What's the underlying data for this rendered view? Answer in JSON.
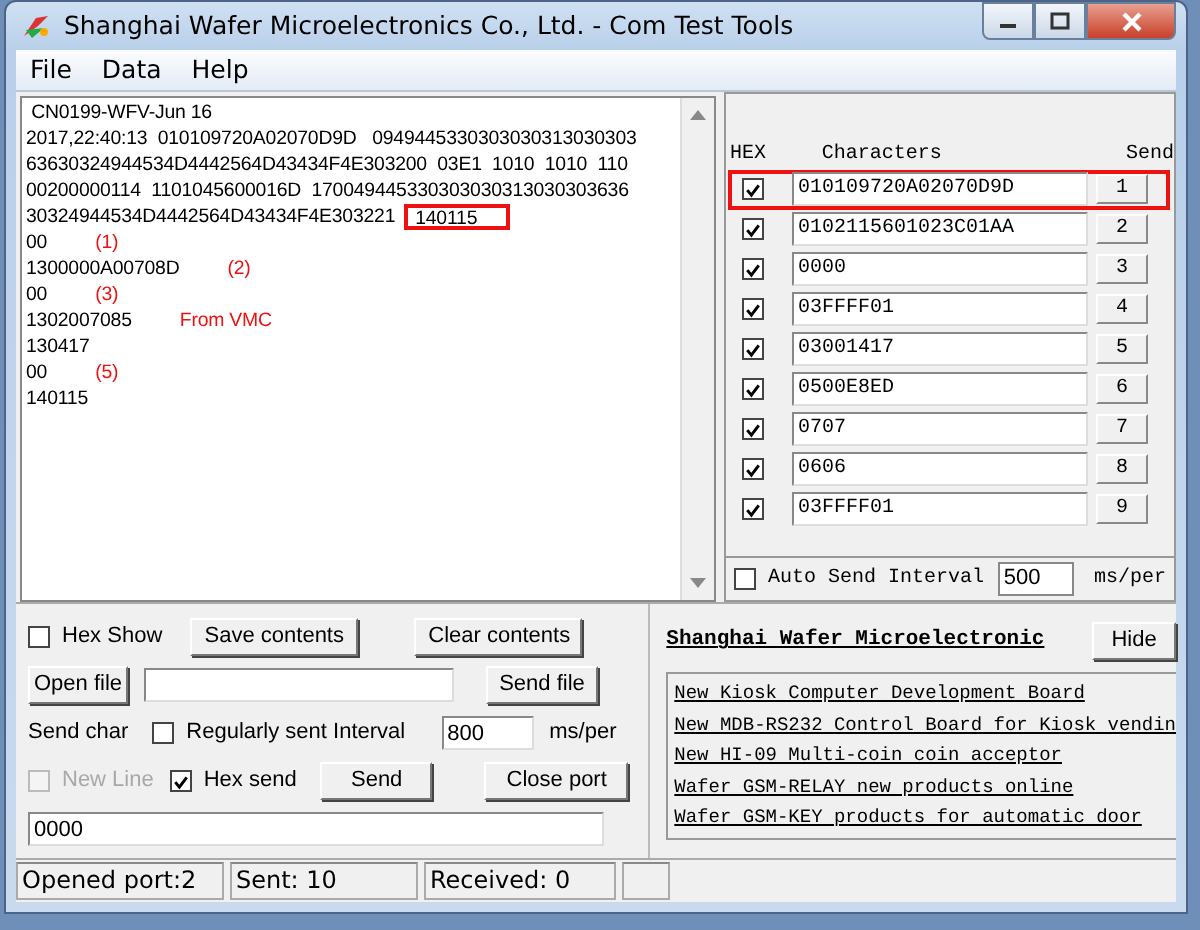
{
  "window": {
    "title": "Shanghai Wafer Microelectronics Co., Ltd. - Com Test Tools"
  },
  "menu": [
    {
      "label": "File"
    },
    {
      "label": "Data"
    },
    {
      "label": "Help"
    }
  ],
  "log": {
    "lines": [
      {
        "text": " CN0199-WFV-Jun 16"
      },
      {
        "text": "2017,22:40:13  010109720A02070D9D   0949445330303030313030303"
      },
      {
        "text": "63630324944534D4442564D43434F4E303200  03E1  1010  1010  110"
      },
      {
        "text": "00200000114  1101045600016D  170049445330303030313030303636"
      },
      {
        "text": "30324944534D4442564D43434F4E303221",
        "boxed": "140115"
      },
      {
        "text": "00",
        "note": "(1)"
      },
      {
        "text": "1300000A00708D",
        "note": "(2)"
      },
      {
        "text": "00",
        "note": "(3)"
      },
      {
        "text": "1302007085",
        "note": "From VMC"
      },
      {
        "text": "130417"
      },
      {
        "text": "00",
        "note": "(5)"
      },
      {
        "text": "140115"
      }
    ]
  },
  "send_list": {
    "columns": [
      "HEX",
      "Characters",
      "Send"
    ],
    "rows": [
      {
        "hex": true,
        "value": "010109720A02070D9D",
        "button": "1",
        "highlighted": true
      },
      {
        "hex": true,
        "value": "0102115601023C01AA",
        "button": "2",
        "highlighted": false
      },
      {
        "hex": true,
        "value": "0000",
        "button": "3",
        "highlighted": false
      },
      {
        "hex": true,
        "value": "03FFFF01",
        "button": "4",
        "highlighted": false
      },
      {
        "hex": true,
        "value": "03001417",
        "button": "5",
        "highlighted": false
      },
      {
        "hex": true,
        "value": "0500E8ED",
        "button": "6",
        "highlighted": false
      },
      {
        "hex": true,
        "value": "0707",
        "button": "7",
        "highlighted": false
      },
      {
        "hex": true,
        "value": "0606",
        "button": "8",
        "highlighted": false
      },
      {
        "hex": true,
        "value": "03FFFF01",
        "button": "9",
        "highlighted": false
      }
    ],
    "auto_send": {
      "label": "Auto Send Interval",
      "checked": false,
      "interval": "500",
      "unit": "ms/per"
    }
  },
  "controls": {
    "hex_show": {
      "label": "Hex Show",
      "checked": false
    },
    "save_button": "Save contents",
    "clear_button": "Clear contents",
    "open_button": "Open file",
    "send_file_button": "Send file",
    "send_char_label": "Send char",
    "regular": {
      "label": "Regularly sent Interval",
      "checked": false
    },
    "interval": "800",
    "interval_unit": "ms/per",
    "new_line": {
      "label": "New Line",
      "checked": false,
      "disabled": true
    },
    "hex_send": {
      "label": "Hex send",
      "checked": true,
      "disabled": false
    },
    "send_button": "Send",
    "close_button": "Close port",
    "send_text": "0000"
  },
  "news": {
    "title": "Shanghai Wafer Microelectronic",
    "hide_button": "Hide",
    "links": [
      "New Kiosk Computer Development Board",
      "New MDB-RS232 Control Board for Kiosk vendin",
      "New HI-09 Multi-coin coin acceptor",
      "Wafer GSM-RELAY new products online",
      "Wafer GSM-KEY products for automatic door"
    ]
  },
  "status_bar": [
    "Opened port:2",
    "Sent: 10",
    "Received: 0"
  ]
}
